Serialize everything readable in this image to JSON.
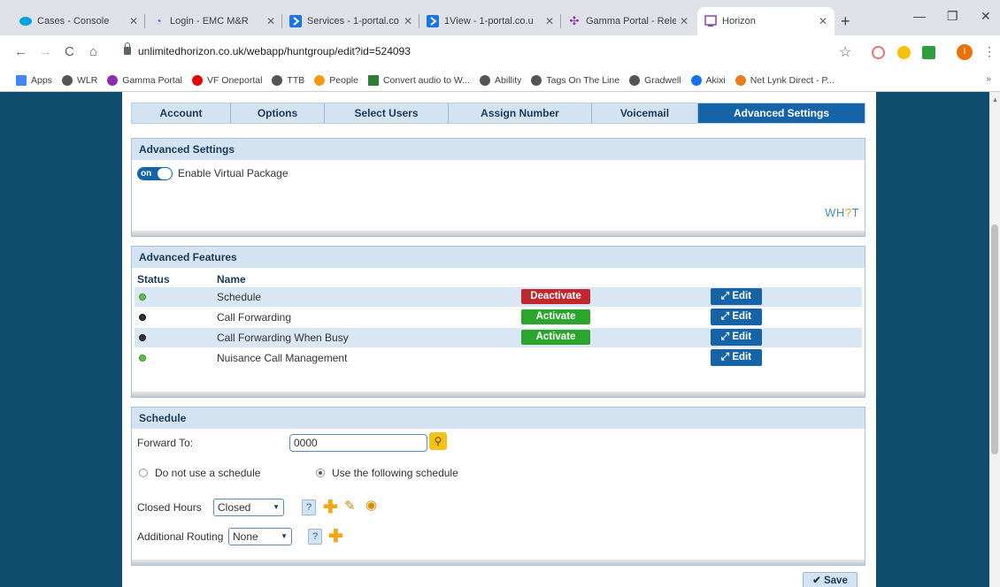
{
  "browser": {
    "tabs": [
      {
        "title": "Cases - Console",
        "icon": "salesforce-icon",
        "color": "#00a1e0"
      },
      {
        "title": "Login - EMC M&R",
        "icon": "wifi-icon",
        "color": "#3367d6"
      },
      {
        "title": "Services - 1-portal.co",
        "icon": "arrow-icon",
        "color": "#1a73e8"
      },
      {
        "title": "1View - 1-portal.co.u",
        "icon": "arrow-icon",
        "color": "#1a73e8"
      },
      {
        "title": "Gamma Portal - Rele",
        "icon": "gamma-icon",
        "color": "#8e2bb0"
      },
      {
        "title": "Horizon",
        "icon": "horizon-icon",
        "color": "#8e44ad"
      }
    ],
    "new_tab": "+",
    "url": "unlimitedhorizon.co.uk/webapp/huntgroup/edit?id=524093",
    "profile_initial": "I",
    "bookmarks": [
      {
        "label": "Apps",
        "icon": "apps-grid-icon",
        "color": "#4285f4"
      },
      {
        "label": "WLR",
        "icon": "globe-icon",
        "color": "#555"
      },
      {
        "label": "Gamma Portal",
        "icon": "gamma-icon",
        "color": "#8e2bb0"
      },
      {
        "label": "VF Oneportal",
        "icon": "vodafone-icon",
        "color": "#e60000"
      },
      {
        "label": "TTB",
        "icon": "globe-icon",
        "color": "#555"
      },
      {
        "label": "People",
        "icon": "people-icon",
        "color": "#f39c12"
      },
      {
        "label": "Convert audio to W...",
        "icon": "convert-icon",
        "color": "#2e7d32"
      },
      {
        "label": "Abillity",
        "icon": "globe-icon",
        "color": "#555"
      },
      {
        "label": "Tags On The Line",
        "icon": "globe-icon",
        "color": "#555"
      },
      {
        "label": "Gradwell",
        "icon": "globe-icon",
        "color": "#555"
      },
      {
        "label": "Akixi",
        "icon": "akixi-icon",
        "color": "#1a73e8"
      },
      {
        "label": "Net Lynk Direct - P...",
        "icon": "netlynk-icon",
        "color": "#e67e22"
      }
    ],
    "bookmarks_more": "»"
  },
  "nav": {
    "tabs": [
      "Account",
      "Options",
      "Select Users",
      "Assign Number",
      "Voicemail",
      "Advanced Settings"
    ],
    "active": "Advanced Settings"
  },
  "advanced_settings": {
    "title": "Advanced Settings",
    "toggle_state": "on",
    "toggle_label": "Enable Virtual Package",
    "logo_prefix": "WH",
    "logo_q": "?",
    "logo_suffix": "T"
  },
  "advanced_features": {
    "title": "Advanced Features",
    "col_status": "Status",
    "col_name": "Name",
    "rows": [
      {
        "name": "Schedule",
        "status": "green",
        "action": "Deactivate",
        "edit": "Edit"
      },
      {
        "name": "Call Forwarding",
        "status": "dark",
        "action": "Activate",
        "edit": "Edit"
      },
      {
        "name": "Call Forwarding When Busy",
        "status": "dark",
        "action": "Activate",
        "edit": "Edit"
      },
      {
        "name": "Nuisance Call Management",
        "status": "green",
        "action": "",
        "edit": "Edit"
      }
    ]
  },
  "schedule": {
    "title": "Schedule",
    "forward_label": "Forward To:",
    "forward_value": "0000",
    "radio_no": "Do not use a schedule",
    "radio_yes": "Use the following schedule",
    "closed_label": "Closed Hours",
    "closed_value": "Closed",
    "routing_label": "Additional Routing",
    "routing_value": "None",
    "help": "?"
  },
  "save_label": "Save",
  "colors": {
    "brand_blue": "#1663a7",
    "page_bg": "#0f4c6e",
    "deactivate": "#c0282d",
    "activate": "#2ca52c"
  }
}
